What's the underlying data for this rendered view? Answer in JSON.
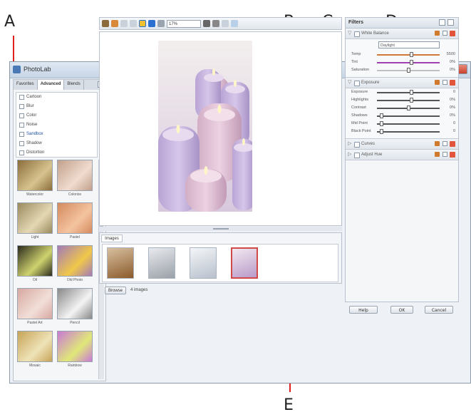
{
  "callouts": {
    "a": "A",
    "b": "B",
    "c": "C",
    "d": "D",
    "e": "E"
  },
  "window": {
    "title": "PhotoLab"
  },
  "left_panel": {
    "tabs": [
      "Favorites",
      "Advanced",
      "Blends"
    ],
    "categories": [
      {
        "label": "Cartoon",
        "selected": false
      },
      {
        "label": "Blur",
        "selected": false
      },
      {
        "label": "Color",
        "selected": false
      },
      {
        "label": "Noise",
        "selected": false
      },
      {
        "label": "Sandbox",
        "selected": true
      },
      {
        "label": "Shadow",
        "selected": false
      },
      {
        "label": "Distortion",
        "selected": false
      }
    ],
    "thumbnails": [
      {
        "label": "Watercolor",
        "c1": "#8b6d3a",
        "c2": "#d7c38f"
      },
      {
        "label": "Colorize",
        "c1": "#c2a08a",
        "c2": "#f0dcd0"
      },
      {
        "label": "Light",
        "c1": "#9a8a5e",
        "c2": "#e4d8b4"
      },
      {
        "label": "Pastel",
        "c1": "#d48a5e",
        "c2": "#f4c4a0"
      },
      {
        "label": "Oil",
        "c1": "#2b2b1e",
        "c2": "#cfd26e"
      },
      {
        "label": "Old Photo",
        "c1": "#a37ab8",
        "c2": "#f0c84a"
      },
      {
        "label": "Pastel Art",
        "c1": "#d6a8a0",
        "c2": "#f2dfd8"
      },
      {
        "label": "Pencil",
        "c1": "#888888",
        "c2": "#f4f4f4"
      },
      {
        "label": "Mosaic",
        "c1": "#c6a458",
        "c2": "#efe3b8"
      },
      {
        "label": "Rainbow",
        "c1": "#c87ad6",
        "c2": "#e0e878"
      }
    ]
  },
  "toolbar": {
    "zoom": "17%"
  },
  "images_panel": {
    "tab_label": "Images",
    "thumbs": [
      {
        "c1": "#8b5a2b",
        "c2": "#d8c0a0",
        "selected": false
      },
      {
        "c1": "#9aa0a8",
        "c2": "#e8eaee",
        "selected": false
      },
      {
        "c1": "#b8c0cc",
        "c2": "#f4f6f8",
        "selected": false
      },
      {
        "c1": "#b89ac8",
        "c2": "#f2e8f0",
        "selected": true
      }
    ],
    "browse_label": "Browse",
    "count_label": "4 images"
  },
  "filters_panel": {
    "title": "Filters",
    "filters": [
      {
        "name": "White Balance",
        "expanded": true,
        "preset": "Daylight",
        "sliders": [
          {
            "label": "Temp",
            "value": "5500",
            "pos": 0.55,
            "track": "#d07a3a"
          },
          {
            "label": "Tint",
            "value": "0%",
            "pos": 0.55,
            "track": "#a040b0"
          },
          {
            "label": "Saturation",
            "value": "0%",
            "pos": 0.5,
            "track": "#c0c0c0"
          }
        ]
      },
      {
        "name": "Exposure",
        "expanded": true,
        "sliders": [
          {
            "label": "Exposure",
            "value": "0",
            "pos": 0.55,
            "track": "#555555"
          },
          {
            "label": "Highlights",
            "value": "0%",
            "pos": 0.55,
            "track": "#555555"
          },
          {
            "label": "Contrast",
            "value": "0%",
            "pos": 0.5,
            "track": "#555555"
          },
          {
            "label": "Shadows",
            "value": "0%",
            "pos": 0.05,
            "track": "#555555"
          },
          {
            "label": "Mid Point",
            "value": "0",
            "pos": 0.05,
            "track": "#555555"
          },
          {
            "label": "Black Point",
            "value": "0",
            "pos": 0.05,
            "track": "#555555"
          }
        ]
      },
      {
        "name": "Curves",
        "expanded": false
      },
      {
        "name": "Adjust Hue",
        "expanded": false
      }
    ],
    "buttons": [
      "Help",
      "OK",
      "Cancel"
    ]
  }
}
